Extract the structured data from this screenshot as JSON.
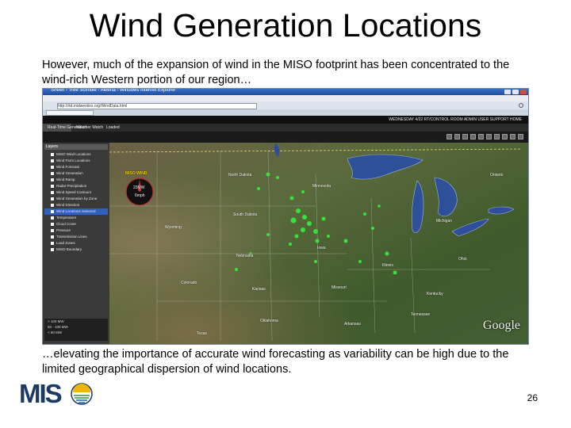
{
  "slide": {
    "title": "Wind Generation Locations",
    "intro_text": "However, much of the expansion of wind in the MISO footprint has been concentrated to the wind-rich Western portion of our region…",
    "outro_text": "…elevating the importance of accurate wind forecasting as variability can be high due to the limited geographical dispersion of wind locations.",
    "page_number": "26",
    "logo_text": "MIS"
  },
  "screenshot": {
    "window_title": "Sheen - Tree Scimble - Alberta - Windows Internet Explorer",
    "address": "http://rtd.midwestiso.org/WindData.html",
    "tabs": [
      "Real-Time Generation",
      "Weather Watch",
      "Loaded"
    ],
    "header_right": "WEDNESDAY 4/22 RT/CONTROL ROOM   ADMIN   USER SUPPORT   HOME",
    "layers_header": "Layers",
    "layers": [
      {
        "label": "MISO Wind Locations",
        "selected": false
      },
      {
        "label": "Wind Farm Locations",
        "selected": false
      },
      {
        "label": "Wind Forecast",
        "selected": false
      },
      {
        "label": "Wind Generation",
        "selected": false
      },
      {
        "label": "Wind Ramp",
        "selected": false
      },
      {
        "label": "Radar Precipitation",
        "selected": false
      },
      {
        "label": "Wind Speed Contours",
        "selected": false
      },
      {
        "label": "Wind Generation by Zone",
        "selected": false
      },
      {
        "label": "Wind Direction",
        "selected": false
      },
      {
        "label": "Wind Locations Selected",
        "selected": true
      },
      {
        "label": "Temperature",
        "selected": false
      },
      {
        "label": "Cloud Cover",
        "selected": false
      },
      {
        "label": "Pressure",
        "selected": false
      },
      {
        "label": "Transmission Lines",
        "selected": false
      },
      {
        "label": "Load Zones",
        "selected": false
      },
      {
        "label": "MISO Boundary",
        "selected": false
      }
    ],
    "legend_items": [
      "> 100 MW",
      "50 - 100 MW",
      "< 50 MW"
    ],
    "compass": {
      "label": "MISO WIND",
      "value1": "23MW",
      "value2": "6mph"
    },
    "map_labels": {
      "north_dakota": "North Dakota",
      "minnesota": "Minnesota",
      "ontario": "Ontario",
      "south_dakota": "South Dakota",
      "wyoming": "Wyoming",
      "nebraska": "Nebraska",
      "iowa": "Iowa",
      "michigan": "Michigan",
      "illinois": "Illinois",
      "colorado": "Colorado",
      "kansas": "Kansas",
      "missouri": "Missouri",
      "ohio": "Ohio",
      "oklahoma": "Oklahoma",
      "texas": "Texas",
      "arkansas": "Arkansas",
      "kentucky": "Kentucky",
      "tennessee": "Tennessee"
    },
    "google_logo": "Google"
  }
}
